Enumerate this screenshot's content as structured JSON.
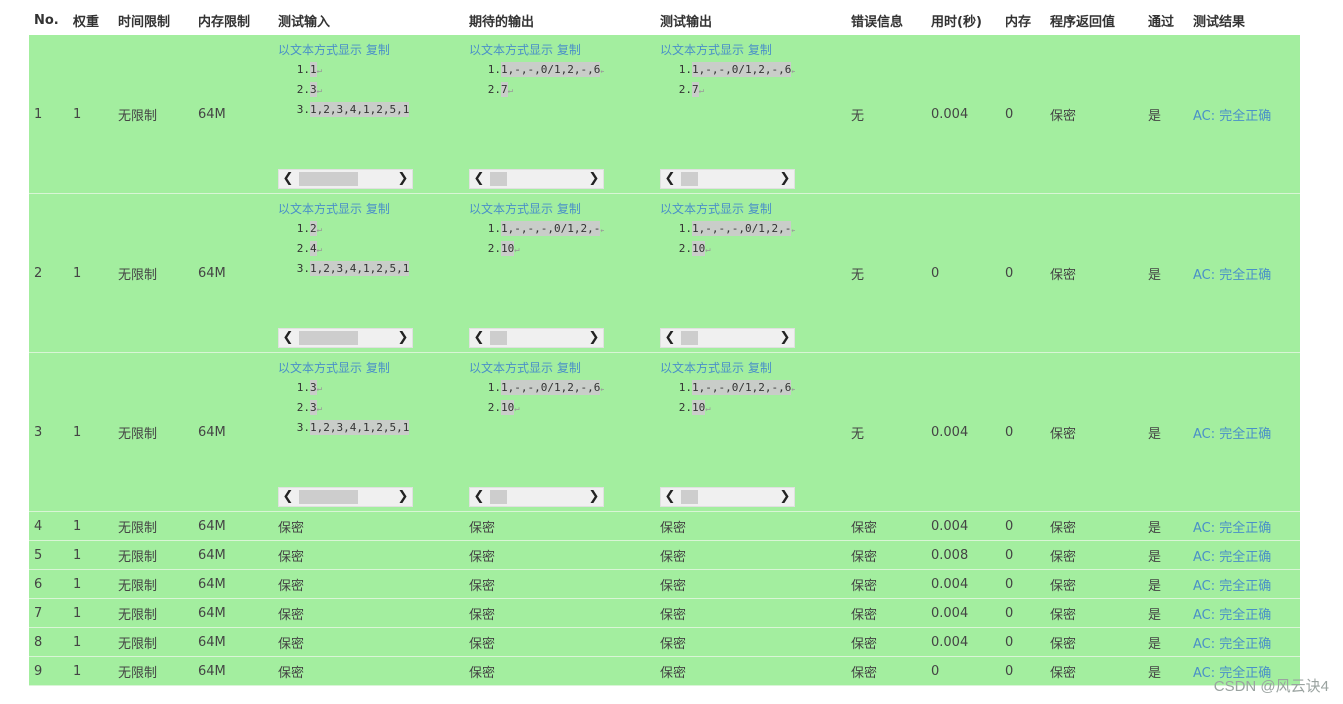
{
  "headers": [
    "No.",
    "权重",
    "时间限制",
    "内存限制",
    "测试输入",
    "期待的输出",
    "测试输出",
    "错误信息",
    "用时(秒)",
    "内存",
    "程序返回值",
    "通过",
    "测试结果"
  ],
  "io_links": {
    "show_text": "以文本方式显示",
    "copy": "复制"
  },
  "newline_glyph": "↵",
  "scroll_glyphs": {
    "left": "❮",
    "right": "❯"
  },
  "rows": [
    {
      "no": "1",
      "weight": "1",
      "time_limit": "无限制",
      "mem_limit": "64M",
      "input": [
        "1",
        "3",
        "1,2,3,4,1,2,5,1"
      ],
      "input_scroll": 0.45,
      "expected": [
        "1,-,-,0/1,2,-,6",
        "7"
      ],
      "expected_scroll": 0.13,
      "output": [
        "1,-,-,0/1,2,-,6",
        "7"
      ],
      "output_scroll": 0.13,
      "error": "无",
      "time": "0.004",
      "memory": "0",
      "return": "保密",
      "pass": "是",
      "result": "AC: 完全正确"
    },
    {
      "no": "2",
      "weight": "1",
      "time_limit": "无限制",
      "mem_limit": "64M",
      "input": [
        "2",
        "4",
        "1,2,3,4,1,2,5,1"
      ],
      "input_scroll": 0.45,
      "expected": [
        "1,-,-,-,0/1,2,-",
        "10"
      ],
      "expected_scroll": 0.13,
      "output": [
        "1,-,-,-,0/1,2,-",
        "10"
      ],
      "output_scroll": 0.13,
      "error": "无",
      "time": "0",
      "memory": "0",
      "return": "保密",
      "pass": "是",
      "result": "AC: 完全正确"
    },
    {
      "no": "3",
      "weight": "1",
      "time_limit": "无限制",
      "mem_limit": "64M",
      "input": [
        "3",
        "3",
        "1,2,3,4,1,2,5,1"
      ],
      "input_scroll": 0.45,
      "expected": [
        "1,-,-,0/1,2,-,6",
        "10"
      ],
      "expected_scroll": 0.13,
      "output": [
        "1,-,-,0/1,2,-,6",
        "10"
      ],
      "output_scroll": 0.13,
      "error": "无",
      "time": "0.004",
      "memory": "0",
      "return": "保密",
      "pass": "是",
      "result": "AC: 完全正确"
    },
    {
      "no": "4",
      "weight": "1",
      "time_limit": "无限制",
      "mem_limit": "64M",
      "input_text": "保密",
      "expected_text": "保密",
      "output_text": "保密",
      "error": "保密",
      "time": "0.004",
      "memory": "0",
      "return": "保密",
      "pass": "是",
      "result": "AC: 完全正确"
    },
    {
      "no": "5",
      "weight": "1",
      "time_limit": "无限制",
      "mem_limit": "64M",
      "input_text": "保密",
      "expected_text": "保密",
      "output_text": "保密",
      "error": "保密",
      "time": "0.008",
      "memory": "0",
      "return": "保密",
      "pass": "是",
      "result": "AC: 完全正确"
    },
    {
      "no": "6",
      "weight": "1",
      "time_limit": "无限制",
      "mem_limit": "64M",
      "input_text": "保密",
      "expected_text": "保密",
      "output_text": "保密",
      "error": "保密",
      "time": "0.004",
      "memory": "0",
      "return": "保密",
      "pass": "是",
      "result": "AC: 完全正确"
    },
    {
      "no": "7",
      "weight": "1",
      "time_limit": "无限制",
      "mem_limit": "64M",
      "input_text": "保密",
      "expected_text": "保密",
      "output_text": "保密",
      "error": "保密",
      "time": "0.004",
      "memory": "0",
      "return": "保密",
      "pass": "是",
      "result": "AC: 完全正确"
    },
    {
      "no": "8",
      "weight": "1",
      "time_limit": "无限制",
      "mem_limit": "64M",
      "input_text": "保密",
      "expected_text": "保密",
      "output_text": "保密",
      "error": "保密",
      "time": "0.004",
      "memory": "0",
      "return": "保密",
      "pass": "是",
      "result": "AC: 完全正确"
    },
    {
      "no": "9",
      "weight": "1",
      "time_limit": "无限制",
      "mem_limit": "64M",
      "input_text": "保密",
      "expected_text": "保密",
      "output_text": "保密",
      "error": "保密",
      "time": "0",
      "memory": "0",
      "return": "保密",
      "pass": "是",
      "result": "AC: 完全正确"
    }
  ],
  "watermark": "CSDN @风云诀4",
  "colors": {
    "row_bg": "#a3ee9f",
    "link": "#4a90c8"
  }
}
